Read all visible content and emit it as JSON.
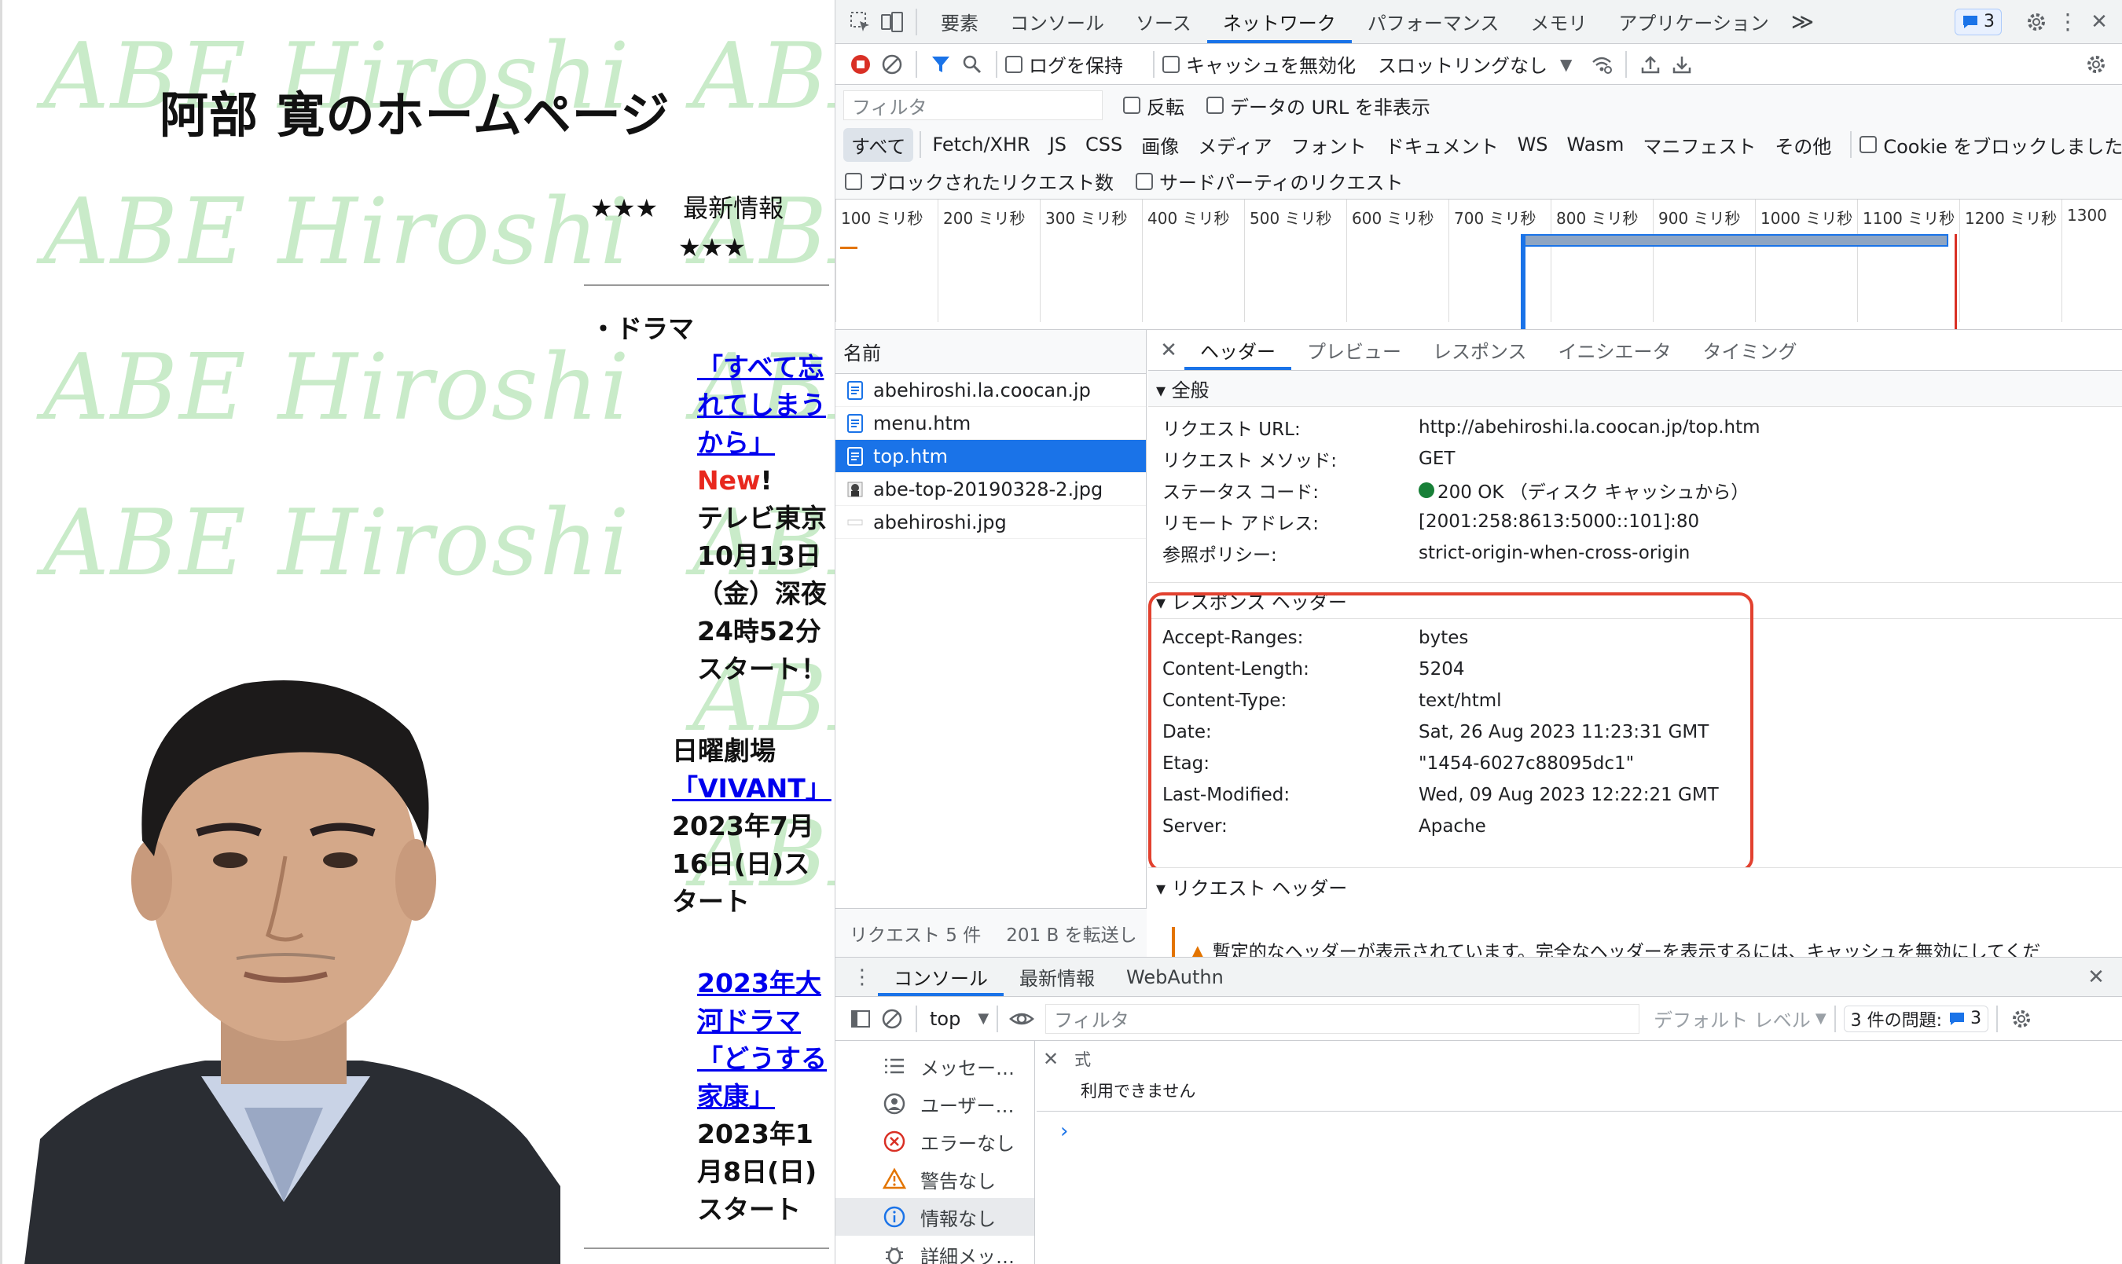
{
  "webpage": {
    "watermark_text": "ABE Hiroshi",
    "site_title": "阿部 寛のホームページ",
    "news_header": {
      "left": "★★★　最新情報",
      "right": "★★★"
    },
    "section_drama": "・ドラマ",
    "news1": {
      "link": "「すべて忘れてしまうから」",
      "new_word": "New",
      "new_mark": "!",
      "text": "テレビ東京10月13日（金）深夜24時52分スタート！"
    },
    "news2": {
      "pre": "日曜劇場",
      "link": "「VIVANT」",
      "text": "2023年7月16日(日)スタート"
    },
    "news3": {
      "link": "2023年大河ドラマ「どうする家康」",
      "text": "2023年1月8日(日)スタート"
    }
  },
  "devtools": {
    "main_tabs": [
      "要素",
      "コンソール",
      "ソース",
      "ネットワーク",
      "パフォーマンス",
      "メモリ",
      "アプリケーション"
    ],
    "active_main_tab": "ネットワーク",
    "more_tabs": "≫",
    "issues_count": "3",
    "toolbar": {
      "preserve_log": "ログを保持",
      "disable_cache": "キャッシュを無効化",
      "throttling": "スロットリングなし"
    },
    "filter": {
      "placeholder": "フィルタ",
      "invert": "反転",
      "hide_data_urls": "データの URL を非表示",
      "types": [
        "すべて",
        "Fetch/XHR",
        "JS",
        "CSS",
        "画像",
        "メディア",
        "フォント",
        "ドキュメント",
        "WS",
        "Wasm",
        "マニフェスト",
        "その他"
      ],
      "blocked_cookies": "Cookie をブロックしました",
      "blocked_requests": "ブロックされたリクエスト数",
      "third_party": "サードパーティのリクエスト"
    },
    "timeline_ticks": [
      "100 ミリ秒",
      "200 ミリ秒",
      "300 ミリ秒",
      "400 ミリ秒",
      "500 ミリ秒",
      "600 ミリ秒",
      "700 ミリ秒",
      "800 ミリ秒",
      "900 ミリ秒",
      "1000 ミリ秒",
      "1100 ミリ秒",
      "1200 ミリ秒",
      "1300"
    ],
    "requests": {
      "column_name": "名前",
      "items": [
        {
          "name": "abehiroshi.la.coocan.jp",
          "kind": "doc"
        },
        {
          "name": "menu.htm",
          "kind": "doc"
        },
        {
          "name": "top.htm",
          "kind": "doc"
        },
        {
          "name": "abe-top-20190328-2.jpg",
          "kind": "img"
        },
        {
          "name": "abehiroshi.jpg",
          "kind": "img-empty"
        }
      ],
      "selected": "top.htm",
      "summary_count": "リクエスト 5 件",
      "summary_transfer": "201 B を転送し"
    },
    "detail_tabs": [
      "ヘッダー",
      "プレビュー",
      "レスポンス",
      "イニシエータ",
      "タイミング"
    ],
    "active_detail_tab": "ヘッダー",
    "general": {
      "title": "▾ 全般",
      "rows": [
        {
          "k": "リクエスト URL:",
          "v": "http://abehiroshi.la.coocan.jp/top.htm"
        },
        {
          "k": "リクエスト メソッド:",
          "v": "GET"
        },
        {
          "k": "ステータス コード:",
          "v": "200 OK （ディスク キャッシュから）"
        },
        {
          "k": "リモート アドレス:",
          "v": "[2001:258:8613:5000::101]:80"
        },
        {
          "k": "参照ポリシー:",
          "v": "strict-origin-when-cross-origin"
        }
      ]
    },
    "response_headers": {
      "title": "▾ レスポンス ヘッダー",
      "rows": [
        {
          "k": "Accept-Ranges:",
          "v": "bytes"
        },
        {
          "k": "Content-Length:",
          "v": "5204"
        },
        {
          "k": "Content-Type:",
          "v": "text/html"
        },
        {
          "k": "Date:",
          "v": "Sat, 26 Aug 2023 11:23:31 GMT"
        },
        {
          "k": "Etag:",
          "v": "\"1454-6027c88095dc1\""
        },
        {
          "k": "Last-Modified:",
          "v": "Wed, 09 Aug 2023 12:22:21 GMT"
        },
        {
          "k": "Server:",
          "v": "Apache"
        }
      ]
    },
    "request_headers": {
      "title": "▾ リクエスト ヘッダー",
      "warning": "暫定的なヘッダーが表示されています。完全なヘッダーを表示するには、キャッシュを無効にしてくだ"
    },
    "drawer": {
      "tabs": [
        "コンソール",
        "最新情報",
        "WebAuthn"
      ],
      "active_tab": "コンソール",
      "context": "top",
      "filter_placeholder": "フィルタ",
      "level": "デフォルト レベル",
      "issues": "3 件の問題:",
      "issues_count": "3",
      "sidebar": [
        "メッセー…",
        "ユーザー…",
        "エラーなし",
        "警告なし",
        "情報なし",
        "詳細メッ…"
      ],
      "expr_label": "式",
      "expr_value": "利用できません",
      "prompt": "›"
    },
    "colors": {
      "accent": "#1a73e8",
      "highlight": "#e2412f",
      "status_ok": "#188038"
    }
  }
}
